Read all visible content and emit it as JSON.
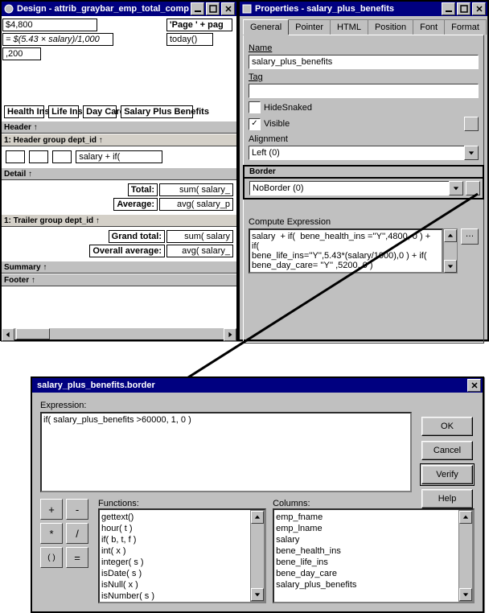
{
  "design": {
    "title": "Design - attrib_graybar_emp_total_comp",
    "top_cells": [
      "$4,800",
      "= $(5.43 × salary)/1,000",
      ",200"
    ],
    "page_cells": [
      "'Page ' + pag",
      "today()"
    ],
    "col_headers": [
      "Health Ins.",
      "Life Ins.",
      "Day Care",
      "Salary Plus Benefits"
    ],
    "bands": {
      "header": "Header ↑",
      "header_group": "1: Header group dept_id ↑",
      "detail": "Detail ↑",
      "trailer_group": "1: Trailer group dept_id ↑",
      "summary": "Summary ↑",
      "footer": "Footer ↑"
    },
    "detail_field": "salary + if(",
    "totals": {
      "total_lbl": "Total:",
      "total_expr": "sum( salary_",
      "avg_lbl": "Average:",
      "avg_expr": "avg( salary_p"
    },
    "grand": {
      "gt_lbl": "Grand total:",
      "gt_expr": "sum( salary",
      "oa_lbl": "Overall average:",
      "oa_expr": "avg( salary_"
    }
  },
  "props": {
    "title": "Properties - salary_plus_benefits",
    "tabs": [
      "General",
      "Pointer",
      "HTML",
      "Position",
      "Font",
      "Format"
    ],
    "labels": {
      "name": "Name",
      "tag": "Tag",
      "hide": "HideSnaked",
      "visible": "Visible",
      "alignment": "Alignment",
      "border": "Border",
      "compute": "Compute Expression"
    },
    "name_value": "salary_plus_benefits",
    "tag_value": "",
    "hide_checked": false,
    "visible_checked": true,
    "alignment_value": "Left (0)",
    "border_value": "NoBorder (0)",
    "compute_lines": [
      "salary  + if(  bene_health_ins =''Y'',4800, 0 ) + if(",
      "bene_life_ins=''Y'',5.43*(salary/1000),0 ) + if(",
      "bene_day_care= ''Y'' ,5200, 0 )"
    ]
  },
  "dlg": {
    "title": "salary_plus_benefits.border",
    "expr_label": "Expression:",
    "expr_value": "if( salary_plus_benefits >60000, 1, 0 )",
    "buttons": {
      "ok": "OK",
      "cancel": "Cancel",
      "verify": "Verify",
      "help": "Help"
    },
    "func_label": "Functions:",
    "col_label": "Columns:",
    "ops": [
      "+",
      "-",
      "*",
      "/",
      "( )",
      "=",
      "<",
      ">",
      "<=",
      ">="
    ],
    "functions": [
      "gettext()",
      "hour( t )",
      "if( b, t, f )",
      "int( x )",
      "integer( s )",
      "isDate( s )",
      "isNull( x )",
      "isNumber( s )"
    ],
    "columns": [
      "emp_fname",
      "emp_lname",
      "salary",
      "bene_health_ins",
      "bene_life_ins",
      "bene_day_care",
      "salary_plus_benefits"
    ]
  }
}
